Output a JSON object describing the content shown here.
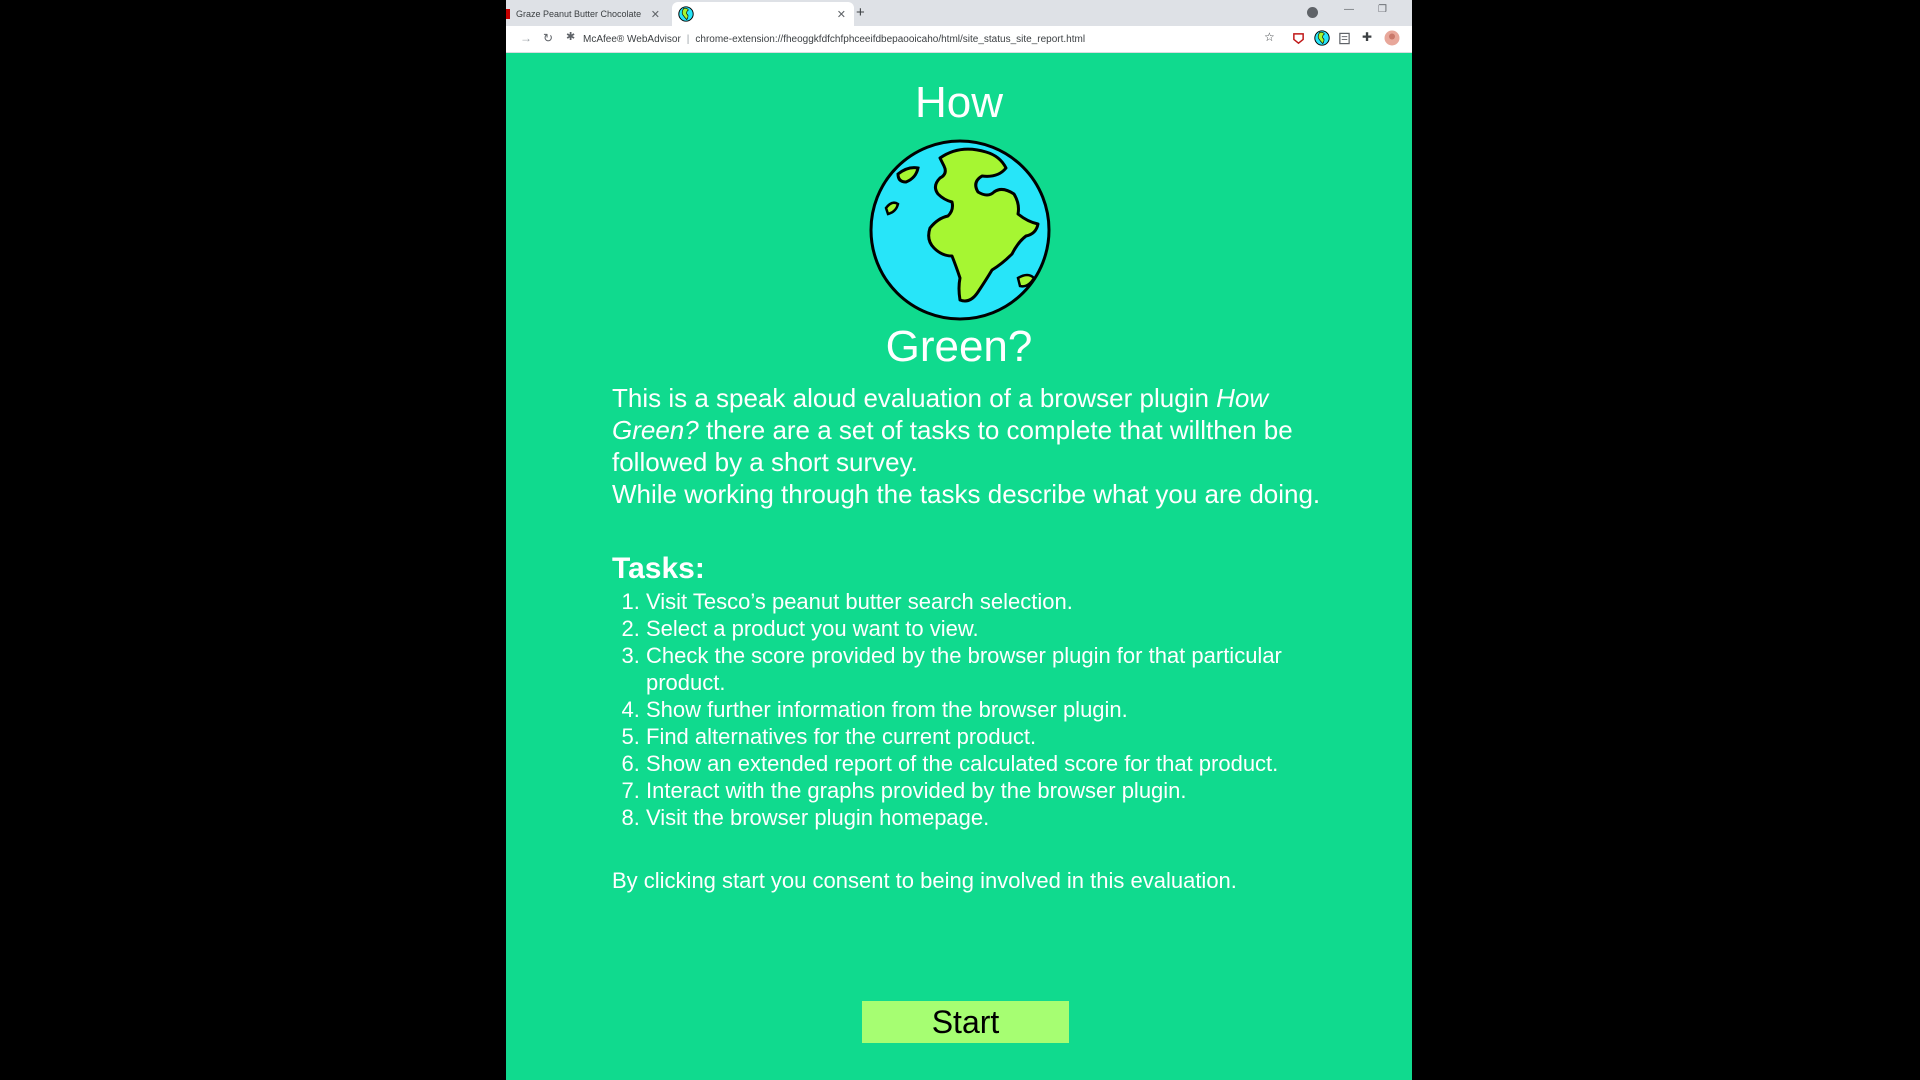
{
  "browser": {
    "tabs": [
      {
        "title": "Graze Peanut Butter Chocolate F",
        "active": false
      },
      {
        "title": "",
        "active": true
      }
    ],
    "new_tab": "+",
    "omnibox": {
      "site_chip": "McAfee® WebAdvisor",
      "separator": "|",
      "url": "chrome-extension://fheoggkfdfchfphceeifdbepaooicaho/html/site_status_site_report.html"
    }
  },
  "page": {
    "title_top": "How",
    "title_bottom": "Green?",
    "intro_part1": "This is a speak aloud evaluation of a browser plugin ",
    "intro_plugin_name": "How Green?",
    "intro_part2": " there are a set of tasks to complete that willthen be followed by a short survey.",
    "intro_line2": "While working through the tasks describe what you are doing.",
    "tasks_heading": "Tasks:",
    "tasks": [
      "Visit Tesco’s peanut butter search selection.",
      "Select a product you want to view.",
      "Check the score provided by the browser plugin for that particular product.",
      "Show further information from the browser plugin.",
      "Find alternatives for the current product.",
      "Show an extended report of the calculated score for that product.",
      "Interact with the graphs provided by the browser plugin.",
      "Visit the browser plugin homepage."
    ],
    "consent": "By clicking start you consent to being involved in this evaluation.",
    "start_label": "Start"
  },
  "colors": {
    "page_background": "#10da8e",
    "start_button": "#a6fe72",
    "ocean": "#27e5f9",
    "land": "#a6f632"
  },
  "icons": [
    "globe-icon",
    "close-icon",
    "reload-icon",
    "forward-icon",
    "star-icon",
    "puzzle-icon",
    "avatar-icon"
  ]
}
